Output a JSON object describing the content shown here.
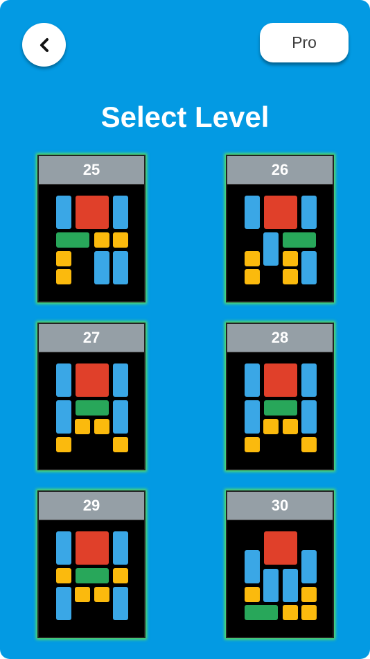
{
  "header": {
    "back_icon": "chevron-left-icon",
    "pro_label": "Pro"
  },
  "title": "Select Level",
  "colors": {
    "background": "#039ae3",
    "card_border_glow": "#5ce05c",
    "tile_blue": "#3aa7e6",
    "tile_red": "#e0402a",
    "tile_green": "#28a75a",
    "tile_yellow": "#fbba0d"
  },
  "levels": [
    {
      "number": "25"
    },
    {
      "number": "26"
    },
    {
      "number": "27"
    },
    {
      "number": "28"
    },
    {
      "number": "29"
    },
    {
      "number": "30"
    }
  ]
}
